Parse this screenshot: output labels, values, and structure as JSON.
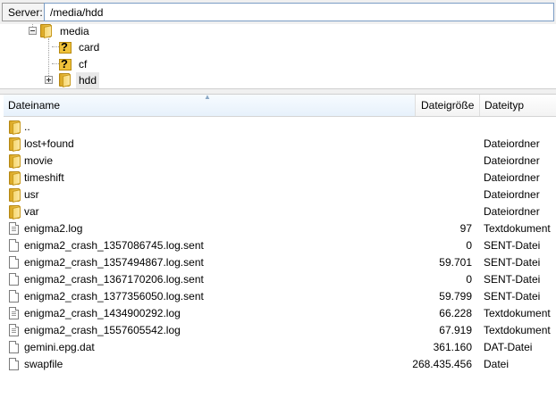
{
  "pathbar": {
    "server_label": "Server:",
    "path_value": "/media/hdd"
  },
  "tree": {
    "parent": {
      "label": "media",
      "icon": "folder-icon",
      "expanded": true
    },
    "children": [
      {
        "label": "card",
        "icon": "unknown-question-icon"
      },
      {
        "label": "cf",
        "icon": "unknown-question-icon"
      },
      {
        "label": "hdd",
        "icon": "folder-icon",
        "selected": true,
        "expandable": true
      }
    ]
  },
  "list": {
    "columns": {
      "name": "Dateiname",
      "size": "Dateigröße",
      "type": "Dateityp"
    },
    "sorted_column": "name",
    "rows": [
      {
        "name": "..",
        "size": "",
        "type": "",
        "icon": "folder-icon"
      },
      {
        "name": "lost+found",
        "size": "",
        "type": "Dateiordner",
        "icon": "folder-icon"
      },
      {
        "name": "movie",
        "size": "",
        "type": "Dateiordner",
        "icon": "folder-icon"
      },
      {
        "name": "timeshift",
        "size": "",
        "type": "Dateiordner",
        "icon": "folder-icon"
      },
      {
        "name": "usr",
        "size": "",
        "type": "Dateiordner",
        "icon": "folder-icon"
      },
      {
        "name": "var",
        "size": "",
        "type": "Dateiordner",
        "icon": "folder-icon"
      },
      {
        "name": "enigma2.log",
        "size": "97",
        "type": "Textdokument",
        "icon": "text-document-icon"
      },
      {
        "name": "enigma2_crash_1357086745.log.sent",
        "size": "0",
        "type": "SENT-Datei",
        "icon": "file-icon"
      },
      {
        "name": "enigma2_crash_1357494867.log.sent",
        "size": "59.701",
        "type": "SENT-Datei",
        "icon": "file-icon"
      },
      {
        "name": "enigma2_crash_1367170206.log.sent",
        "size": "0",
        "type": "SENT-Datei",
        "icon": "file-icon"
      },
      {
        "name": "enigma2_crash_1377356050.log.sent",
        "size": "59.799",
        "type": "SENT-Datei",
        "icon": "file-icon"
      },
      {
        "name": "enigma2_crash_1434900292.log",
        "size": "66.228",
        "type": "Textdokument",
        "icon": "text-document-icon"
      },
      {
        "name": "enigma2_crash_1557605542.log",
        "size": "67.919",
        "type": "Textdokument",
        "icon": "text-document-icon"
      },
      {
        "name": "gemini.epg.dat",
        "size": "361.160",
        "type": "DAT-Datei",
        "icon": "file-icon"
      },
      {
        "name": "swapfile",
        "size": "268.435.456",
        "type": "Datei",
        "icon": "file-icon"
      }
    ]
  }
}
